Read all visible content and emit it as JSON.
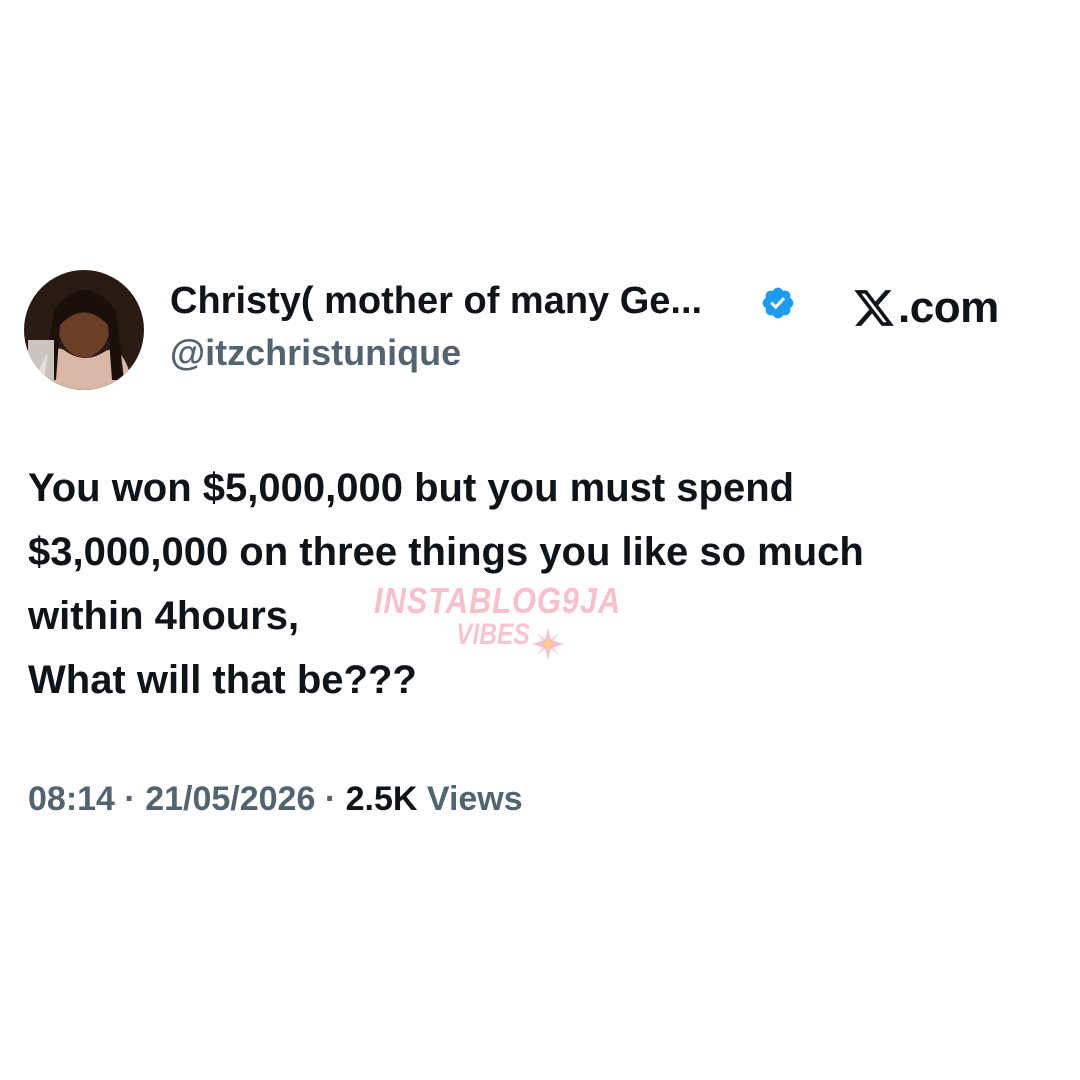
{
  "author": {
    "display_name": "Christy( mother of many Ge...",
    "handle": "@itzchristunique",
    "verified": true,
    "verified_color": "#1d9bf0"
  },
  "branding": {
    "site": ".com",
    "logo_icon": "x-logo-icon"
  },
  "tweet": {
    "lines": [
      "You won $5,000,000 but you must spend",
      "$3,000,000 on three things you like so much",
      "within 4hours,",
      "What will that be???"
    ]
  },
  "watermark": {
    "main": "INSTABLOG9JA",
    "sub": "VIBES"
  },
  "meta": {
    "time": "08:14",
    "separator": "·",
    "date": "21/05/2026",
    "views_count": "2.5K",
    "views_label": "Views"
  }
}
